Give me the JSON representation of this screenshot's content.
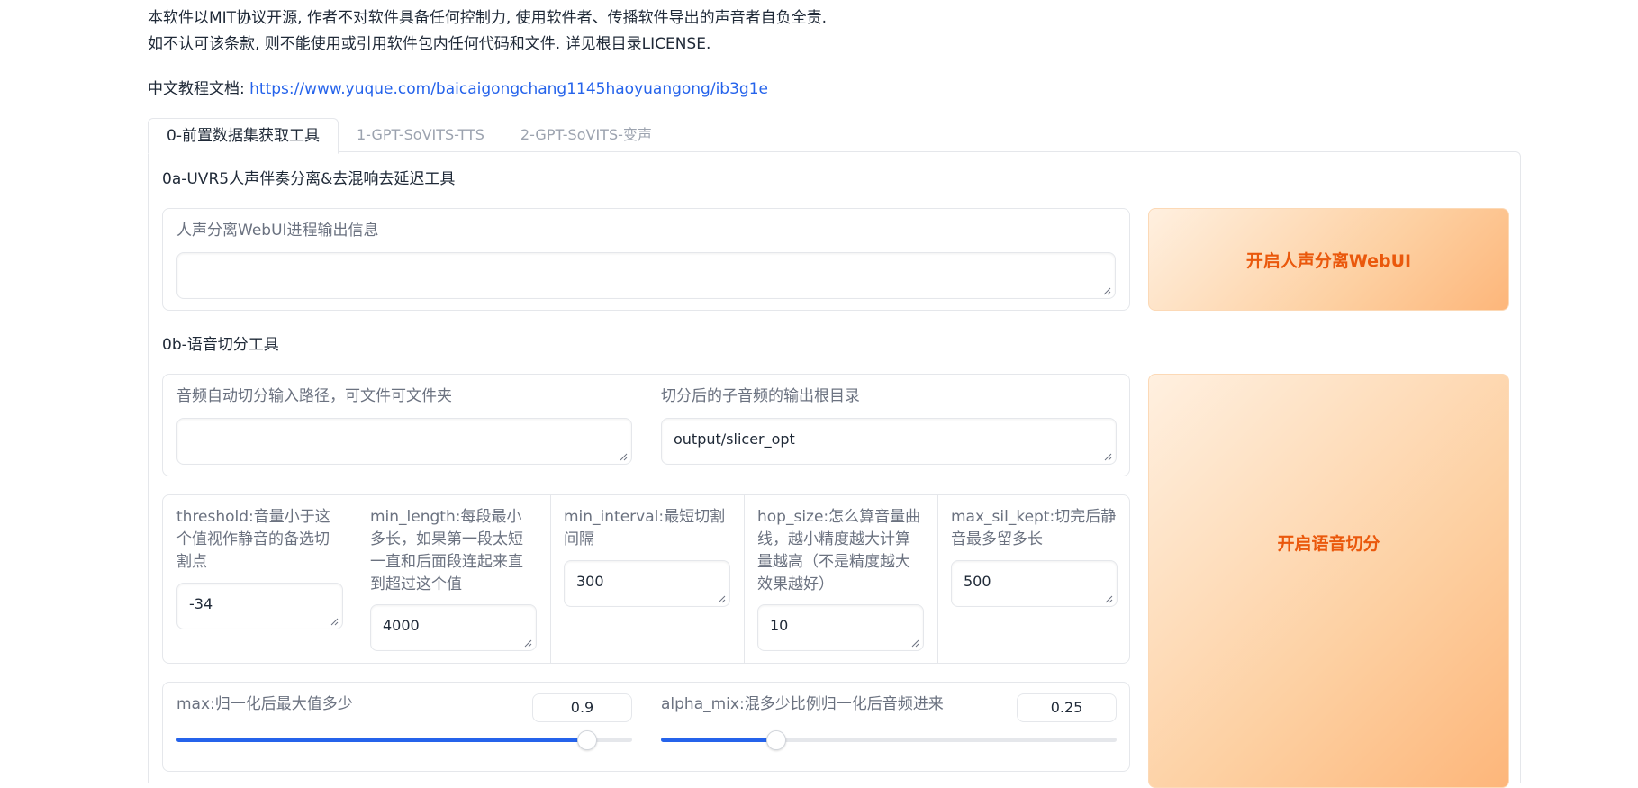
{
  "intro": {
    "line1": "本软件以MIT协议开源, 作者不对软件具备任何控制力, 使用软件者、传播软件导出的声音者自负全责.",
    "line2": "如不认可该条款, 则不能使用或引用软件包内任何代码和文件. 详见根目录LICENSE.",
    "doc_label": "中文教程文档: ",
    "doc_link": "https://www.yuque.com/baicaigongchang1145haoyuangong/ib3g1e"
  },
  "tabs": [
    {
      "label": "0-前置数据集获取工具",
      "active": true
    },
    {
      "label": "1-GPT-SoVITS-TTS",
      "active": false
    },
    {
      "label": "2-GPT-SoVITS-变声",
      "active": false
    }
  ],
  "uvr5": {
    "title": "0a-UVR5人声伴奏分离&去混响去延迟工具",
    "output_label": "人声分离WebUI进程输出信息",
    "output_value": "",
    "button": "开启人声分离WebUI"
  },
  "slicer": {
    "title": "0b-语音切分工具",
    "input_label": "音频自动切分输入路径，可文件可文件夹",
    "input_value": "",
    "output_label": "切分后的子音频的输出根目录",
    "output_value": "output/slicer_opt",
    "params": [
      {
        "label": "threshold:音量小于这个值视作静音的备选切割点",
        "value": "-34"
      },
      {
        "label": "min_length:每段最小多长，如果第一段太短一直和后面段连起来直到超过这个值",
        "value": "4000"
      },
      {
        "label": "min_interval:最短切割间隔",
        "value": "300"
      },
      {
        "label": "hop_size:怎么算音量曲线，越小精度越大计算量越高（不是精度越大效果越好）",
        "value": "10"
      },
      {
        "label": "max_sil_kept:切完后静音最多留多长",
        "value": "500"
      }
    ],
    "max_label": "max:归一化后最大值多少",
    "max_value": "0.9",
    "max_fraction": 0.9,
    "alpha_label": "alpha_mix:混多少比例归一化后音频进来",
    "alpha_value": "0.25",
    "alpha_fraction": 0.25,
    "button": "开启语音切分"
  },
  "colors": {
    "accent": "#2563eb",
    "button_text": "#ea580c"
  }
}
